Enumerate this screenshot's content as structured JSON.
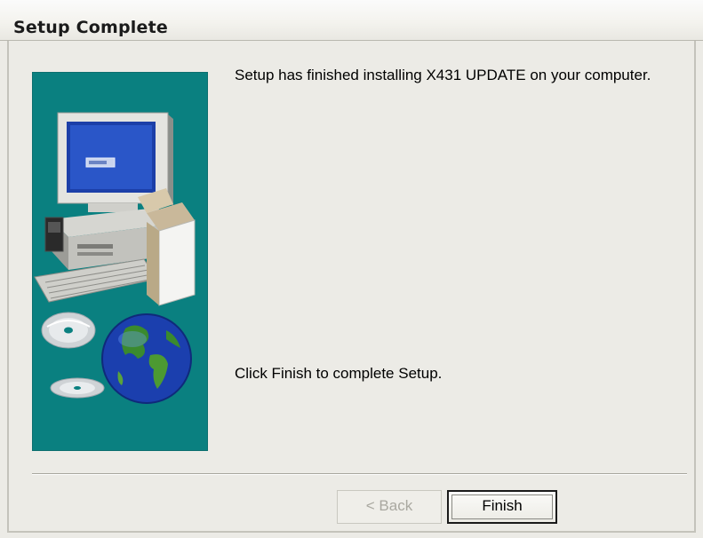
{
  "window": {
    "title": "Setup Complete"
  },
  "content": {
    "finished_message": "Setup has finished installing X431 UPDATE on your computer.",
    "instruction": "Click Finish to complete Setup."
  },
  "buttons": {
    "back_label": "< Back",
    "back_enabled": false,
    "finish_label": "Finish"
  },
  "graphic": {
    "icon": "computer-cd-globe-installer-graphic",
    "background_color": "#0a8080"
  }
}
